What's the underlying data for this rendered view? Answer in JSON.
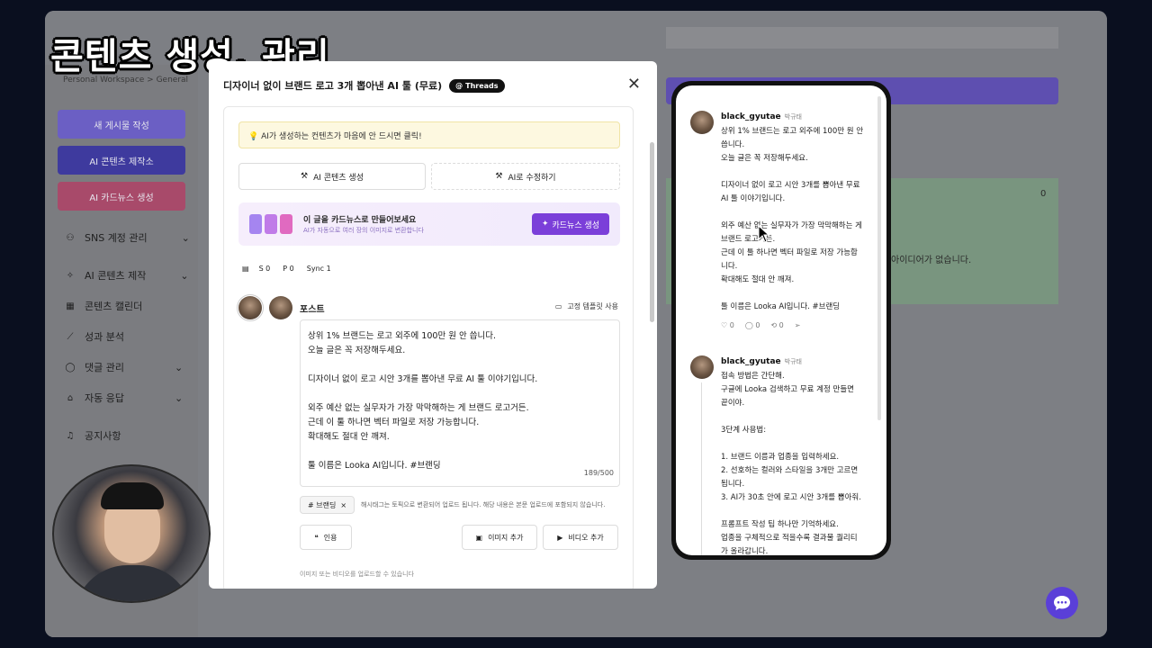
{
  "video_title": "콘텐츠 생성, 관리",
  "background_app": {
    "breadcrumb": "Personal Workspace > General",
    "buttons": [
      {
        "label": "새 게시물 작성",
        "color": "#6b5fc4"
      },
      {
        "label": "AI 콘텐츠 제작소",
        "color": "#3e3a9e"
      },
      {
        "label": "AI 카드뉴스 생성",
        "color": "#a84a6a"
      }
    ],
    "nav": [
      {
        "label": "SNS 계정 관리",
        "icon": "users-icon",
        "glyph": "⚇",
        "chevron": "⌄"
      },
      {
        "label": "AI 콘텐츠 제작",
        "icon": "sparkle-icon",
        "glyph": "✧",
        "chevron": "⌄"
      },
      {
        "label": "콘텐츠 캘린더",
        "icon": "grid-icon",
        "glyph": "▦"
      },
      {
        "label": "성과 분석",
        "icon": "chart-icon",
        "glyph": "⟋"
      },
      {
        "label": "댓글 관리",
        "icon": "comment-icon",
        "glyph": "◯",
        "chevron": "⌄"
      },
      {
        "label": "자동 응답",
        "icon": "robot-icon",
        "glyph": "⌂",
        "chevron": "⌄"
      },
      {
        "label": "공지사항",
        "icon": "bell-icon",
        "glyph": "♫"
      }
    ],
    "empty_text": "아이디어가 없습니다.",
    "count_zero": "0"
  },
  "modal": {
    "title": "디자이너 없이 브랜드 로고 3개 뽑아낸 AI 툴 (무료)",
    "badge": "Threads",
    "close_glyph": "✕",
    "tip": "💡 AI가 생성하는 컨텐츠가 마음에 안 드시면 클릭!",
    "ai_generate": "AI 콘텐츠 생성",
    "ai_edit": "AI로 수정하기",
    "promo_title": "이 글을 카드뉴스로 만들어보세요",
    "promo_sub": "AI가 자동으로 여러 장의 이미지로 변환합니다",
    "promo_button": "카드뉴스 생성",
    "stats": {
      "s": "S 0",
      "p": "P 0",
      "sync": "Sync 1"
    },
    "post_label": "포스트",
    "template_label": "고정 템플릿 사용",
    "editor_lines": [
      "상위 1% 브랜드는 로고 외주에 100만 원 안 씁니다.",
      "오늘 글은 꼭 저장해두세요.",
      "",
      "디자이너 없이 로고 시안 3개를 뽑아낸 무료 AI 툴 이야기입니다.",
      "",
      "외주 예산 없는 실무자가 가장 막막해하는 게 브랜드 로고거든.",
      "근데 이 툴 하나면 벡터 파일로 저장 가능합니다.",
      "확대해도 절대 안 깨져.",
      "",
      "툴 이름은 Looka AI입니다. #브랜딩"
    ],
    "char_count": "189/500",
    "hashtag": "# 브랜딩",
    "hashtag_remove": "×",
    "hashtag_note": "해시태그는 토픽으로 변환되어 업로드 됩니다. 해당 내용은 본문 업로드에 포함되지 않습니다.",
    "quote_button": "인용",
    "image_button": "이미지 추가",
    "video_button": "비디오 추가",
    "upload_note": "이미지 또는 비디오를 업로드할 수 있습니다"
  },
  "preview": {
    "posts": [
      {
        "username": "black_gyutae",
        "display_name": "박규태",
        "lines": [
          "상위 1% 브랜드는 로고 외주에 100만 원 안",
          "씁니다.",
          "오늘 글은 꼭 저장해두세요.",
          "",
          "디자이너 없이 로고 시안 3개를 뽑아낸 무료",
          "AI 툴 이야기입니다.",
          "",
          "외주 예산 없는 실무자가 가장 막막해하는 게",
          "브랜드 로고거든.",
          "근데 이 툴 하나면 벡터 파일로 저장 가능합",
          "니다.",
          "확대해도 절대 안 깨져.",
          "",
          "툴 이름은 Looka AI입니다. #브랜딩"
        ],
        "likes": "0",
        "comments": "0",
        "reposts": "0"
      },
      {
        "username": "black_gyutae",
        "display_name": "박규태",
        "lines": [
          "접속 방법은 간단해.",
          "구글에 Looka 검색하고 무료 계정 만들면",
          "끝이야.",
          "",
          "3단계 사용법:",
          "",
          "1. 브랜드 이름과 업종을 입력하세요.",
          "2. 선호하는 컬러와 스타일을 3개만 고르면",
          "됩니다.",
          "3. AI가 30초 안에 로고 시안 3개를 뽑아줘.",
          "",
          "프롬프트 작성 팁 하나만 기억하세요.",
          "업종을 구체적으로 적을수록 결과물 퀄리티",
          "가 올라갑니다."
        ]
      }
    ]
  },
  "colors": {
    "accent_purple": "#7b3fd9",
    "chat_fab": "#5a3fd8",
    "tip_bg": "#fdf8e0"
  }
}
